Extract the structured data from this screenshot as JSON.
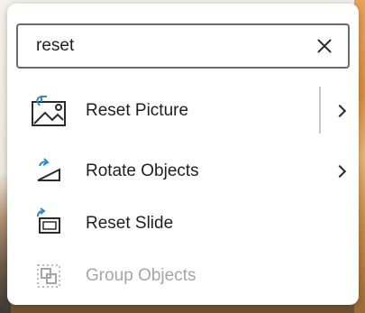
{
  "search": {
    "value": "reset",
    "placeholder": ""
  },
  "items": [
    {
      "label": "Reset Picture",
      "icon": "reset-picture-icon",
      "has_submenu": true,
      "enabled": true
    },
    {
      "label": "Rotate Objects",
      "icon": "rotate-objects-icon",
      "has_submenu": true,
      "enabled": true
    },
    {
      "label": "Reset Slide",
      "icon": "reset-slide-icon",
      "has_submenu": false,
      "enabled": true
    },
    {
      "label": "Group Objects",
      "icon": "group-objects-icon",
      "has_submenu": false,
      "enabled": false
    }
  ],
  "colors": {
    "accent": "#2e8bc9",
    "text": "#1f1f1f",
    "disabled": "#a6a6a6"
  }
}
